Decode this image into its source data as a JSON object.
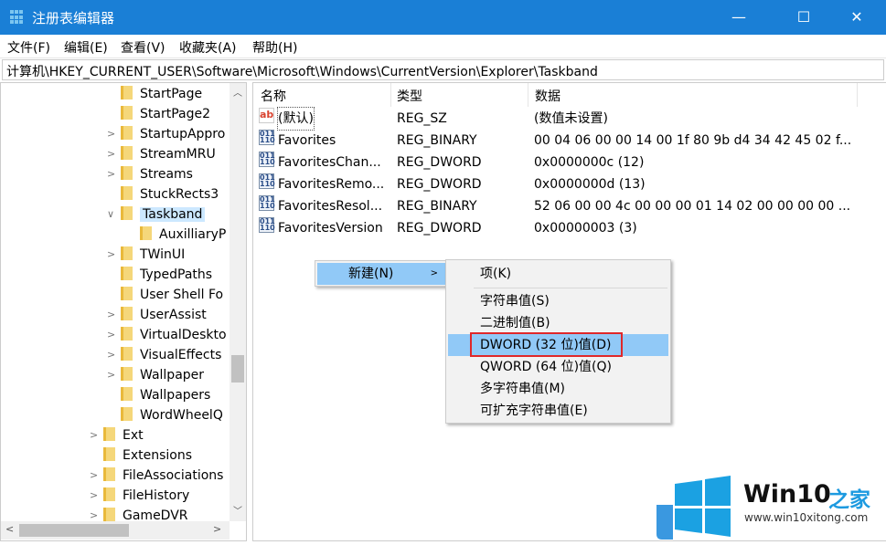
{
  "window": {
    "title": "注册表编辑器",
    "minimize": "—",
    "maximize": "☐",
    "close": "✕"
  },
  "menu": [
    "文件(F)",
    "编辑(E)",
    "查看(V)",
    "收藏夹(A)",
    "帮助(H)"
  ],
  "address": "计算机\\HKEY_CURRENT_USER\\Software\\Microsoft\\Windows\\CurrentVersion\\Explorer\\Taskband",
  "tree": [
    {
      "label": "StartPage",
      "level": 2,
      "expand": false
    },
    {
      "label": "StartPage2",
      "level": 2,
      "expand": false
    },
    {
      "label": "StartupAppro",
      "level": 2,
      "expand": true
    },
    {
      "label": "StreamMRU",
      "level": 2,
      "expand": true
    },
    {
      "label": "Streams",
      "level": 2,
      "expand": true
    },
    {
      "label": "StuckRects3",
      "level": 2,
      "expand": false
    },
    {
      "label": "Taskband",
      "level": 2,
      "expand": "open",
      "selected": true
    },
    {
      "label": "AuxilliaryP",
      "level": 3,
      "expand": false
    },
    {
      "label": "TWinUI",
      "level": 2,
      "expand": true
    },
    {
      "label": "TypedPaths",
      "level": 2,
      "expand": false
    },
    {
      "label": "User Shell Fo",
      "level": 2,
      "expand": false
    },
    {
      "label": "UserAssist",
      "level": 2,
      "expand": true
    },
    {
      "label": "VirtualDeskto",
      "level": 2,
      "expand": true
    },
    {
      "label": "VisualEffects",
      "level": 2,
      "expand": true
    },
    {
      "label": "Wallpaper",
      "level": 2,
      "expand": true
    },
    {
      "label": "Wallpapers",
      "level": 2,
      "expand": false
    },
    {
      "label": "WordWheelQ",
      "level": 2,
      "expand": false
    },
    {
      "label": "Ext",
      "level": 1,
      "expand": true
    },
    {
      "label": "Extensions",
      "level": 1,
      "expand": false
    },
    {
      "label": "FileAssociations",
      "level": 1,
      "expand": true
    },
    {
      "label": "FileHistory",
      "level": 1,
      "expand": true
    },
    {
      "label": "GameDVR",
      "level": 1,
      "expand": true
    }
  ],
  "columns": {
    "name": "名称",
    "type": "类型",
    "data": "数据"
  },
  "values": [
    {
      "icon": "string-value-icon",
      "name": "(默认)",
      "type": "REG_SZ",
      "data": "(数值未设置)"
    },
    {
      "icon": "binary-value-icon",
      "name": "Favorites",
      "type": "REG_BINARY",
      "data": "00 04 06 00 00 14 00 1f 80 9b d4 34 42 45 02 f..."
    },
    {
      "icon": "binary-value-icon",
      "name": "FavoritesChan...",
      "type": "REG_DWORD",
      "data": "0x0000000c (12)"
    },
    {
      "icon": "binary-value-icon",
      "name": "FavoritesRemo...",
      "type": "REG_DWORD",
      "data": "0x0000000d (13)"
    },
    {
      "icon": "binary-value-icon",
      "name": "FavoritesResol...",
      "type": "REG_BINARY",
      "data": "52 06 00 00 4c 00 00 00 01 14 02 00 00 00 00 ..."
    },
    {
      "icon": "binary-value-icon",
      "name": "FavoritesVersion",
      "type": "REG_DWORD",
      "data": "0x00000003 (3)"
    }
  ],
  "context_menu": {
    "new": "新建(N)"
  },
  "submenu": [
    "项(K)",
    "字符串值(S)",
    "二进制值(B)",
    "DWORD (32 位)值(D)",
    "QWORD (64 位)值(Q)",
    "多字符串值(M)",
    "可扩充字符串值(E)"
  ],
  "highlighted": "DWORD (32 位)值(D)",
  "watermark": {
    "brand": "Win10",
    "brand_cn": "之家",
    "url": "www.win10xitong.com"
  },
  "colors": {
    "titlebar": "#1a7fd6",
    "highlight": "#91c9f7",
    "redbox": "#e0282a",
    "selected": "#cce8ff"
  }
}
